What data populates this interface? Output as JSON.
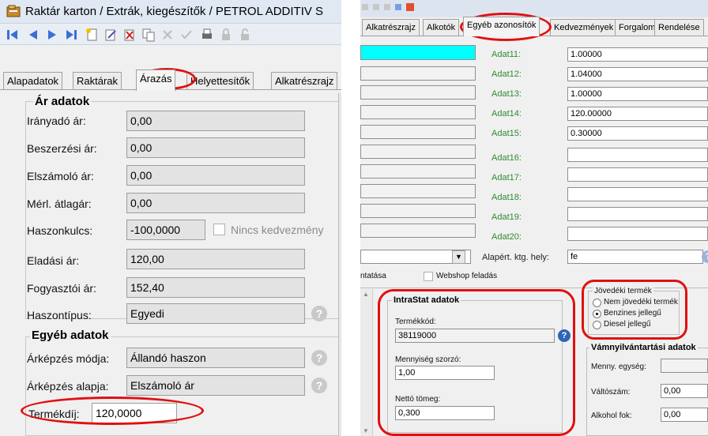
{
  "left": {
    "window_title": "Raktár karton / Extrák, kiegészítők / PETROL ADDITIV S",
    "tabs": [
      {
        "label": "Alapadatok"
      },
      {
        "label": "Raktárak"
      },
      {
        "label": "Árazás"
      },
      {
        "label": "Helyettesítők"
      },
      {
        "label": "Alkatrészrajz"
      }
    ],
    "ar_adatok": {
      "title": "Ár adatok",
      "fields": [
        {
          "label": "Irányadó ár:",
          "value": "0,00"
        },
        {
          "label": "Beszerzési ár:",
          "value": "0,00"
        },
        {
          "label": "Elszámoló ár:",
          "value": "0,00"
        },
        {
          "label": "Mérl. átlagár:",
          "value": "0,00"
        },
        {
          "label": "Haszonkulcs:",
          "value": "-100,0000"
        },
        {
          "label": "Eladási ár:",
          "value": "120,00"
        },
        {
          "label": "Fogyasztói ár:",
          "value": "152,40"
        },
        {
          "label": "Haszontípus:",
          "value": "Egyedi"
        }
      ],
      "nincs_kedvezmeny": "Nincs kedvezmény"
    },
    "egyeb_adatok": {
      "title": "Egyéb adatok",
      "fields": [
        {
          "label": "Árképzés módja:",
          "value": "Állandó haszon"
        },
        {
          "label": "Árképzés alapja:",
          "value": "Elszámoló ár"
        },
        {
          "label": "Termékdíj:",
          "value": "120,0000"
        }
      ]
    }
  },
  "right": {
    "tabs": [
      {
        "label": "Alkatrészrajz"
      },
      {
        "label": "Alkotók"
      },
      {
        "label": "Egyéb azonosítók"
      },
      {
        "label": "Kedvezmények"
      },
      {
        "label": "Forgalom"
      },
      {
        "label": "Rendelése"
      }
    ],
    "adat_fields": [
      {
        "label": "Adat11:",
        "value": "1.00000"
      },
      {
        "label": "Adat12:",
        "value": "1.04000"
      },
      {
        "label": "Adat13:",
        "value": "1.00000"
      },
      {
        "label": "Adat14:",
        "value": "120.00000"
      },
      {
        "label": "Adat15:",
        "value": "0.30000"
      },
      {
        "label": "Adat16:",
        "value": ""
      },
      {
        "label": "Adat17:",
        "value": ""
      },
      {
        "label": "Adat18:",
        "value": ""
      },
      {
        "label": "Adat19:",
        "value": ""
      },
      {
        "label": "Adat20:",
        "value": ""
      }
    ],
    "alapert_label": "Alapért. ktg. hely:",
    "alapert_value": "fe",
    "partial_label": "ntatása",
    "webshop_label": "Webshop feladás",
    "intrastat": {
      "title": "IntraStat adatok",
      "termekkod_label": "Termékkód:",
      "termekkod_value": "38119000",
      "menny_label": "Mennyiség szorzó:",
      "menny_value": "1,00",
      "netto_label": "Nettó tömeg:",
      "netto_value": "0,300"
    },
    "jovedeki": {
      "title": "Jövedéki termék",
      "options": [
        {
          "label": "Nem jövedéki termék",
          "selected": false
        },
        {
          "label": "Benzines jellegű",
          "selected": true
        },
        {
          "label": "Diesel jellegű",
          "selected": false
        }
      ]
    },
    "vamnyil": {
      "title": "Vámnyilvántartási adatok",
      "menny_egyseg_label": "Menny. egység:",
      "menny_egyseg_value": "",
      "valtoszam_label": "Váltószám:",
      "valtoszam_value": "0,00",
      "alkohol_label": "Alkohol fok:",
      "alkohol_value": "0,00"
    }
  },
  "colors": {
    "highlight_oval": "#e01010",
    "field_label_green": "#2e8b2e",
    "selected_row_cyan": "#00ffff"
  }
}
